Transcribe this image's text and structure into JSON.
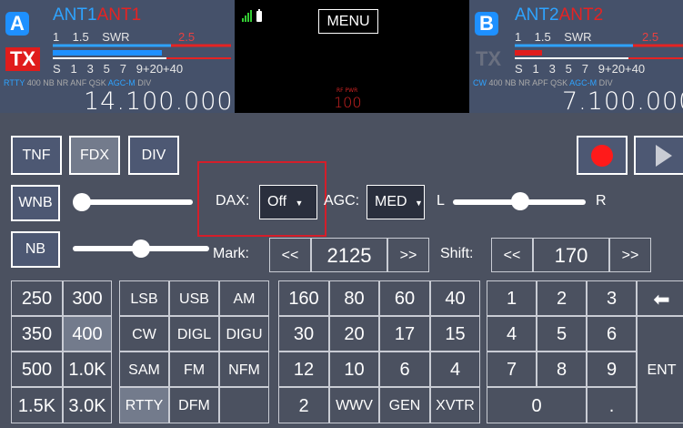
{
  "slice_a": {
    "letter": "A",
    "ant_rx": "ANT1",
    "ant_tx": "ANT1",
    "tx_badge": "TX",
    "meter_scale_top": "1    1.5    SWR",
    "meter_scale_top_red": "2.5",
    "meter_scale_top_red2": "",
    "meter_scale_bottom": "S   1   3   5   7   9+20+40",
    "mode": "RTTY",
    "filter": "400",
    "flags": "NB NR ANF QSK",
    "agc": "AGC-M",
    "div": "DIV",
    "frequency": "14.100.000"
  },
  "center": {
    "menu_label": "MENU",
    "rfpwr_label": "RF PWR",
    "rfpwr_value": "100"
  },
  "slice_b": {
    "letter": "B",
    "ant_rx": "ANT2",
    "ant_tx": "ANT2",
    "tx_badge": "TX",
    "meter_scale_top": "1    1.5    SWR",
    "meter_scale_top_red": "2.5",
    "meter_scale_bottom": "S   1   3   5   7   9+20+40",
    "mode": "CW",
    "filter": "400",
    "flags": "NB NR APF QSK",
    "agc": "AGC-M",
    "div": "DIV",
    "frequency": "7.100.000"
  },
  "toolbar": {
    "tnf": "TNF",
    "fdx": "FDX",
    "div": "DIV"
  },
  "controls": {
    "wnb": "WNB",
    "nb": "NB",
    "dax_label": "DAX:",
    "dax_value": "Off",
    "agc_label": "AGC:",
    "agc_value": "MED",
    "pan_left": "L",
    "pan_right": "R",
    "mark_label": "Mark:",
    "mark_down": "<<",
    "mark_value": "2125",
    "mark_up": ">>",
    "shift_label": "Shift:",
    "shift_down": "<<",
    "shift_value": "170",
    "shift_up": ">>"
  },
  "filters": [
    "250",
    "300",
    "350",
    "400",
    "500",
    "1.0K",
    "1.5K",
    "3.0K"
  ],
  "modes": [
    "LSB",
    "USB",
    "AM",
    "CW",
    "DIGL",
    "DIGU",
    "SAM",
    "FM",
    "NFM",
    "RTTY",
    "DFM",
    ""
  ],
  "bands": [
    "160",
    "80",
    "60",
    "40",
    "30",
    "20",
    "17",
    "15",
    "12",
    "10",
    "6",
    "4",
    "2",
    "WWV",
    "GEN",
    "XVTR"
  ],
  "keypad": [
    "1",
    "2",
    "3",
    "4",
    "5",
    "6",
    "7",
    "8",
    "9",
    "0",
    "."
  ],
  "keypad_back": "⬅",
  "keypad_ent": "ENT",
  "colors": {
    "accent": "#1e90ff",
    "tx_red": "#e01c1c",
    "record": "#ff1a1a",
    "highlight_box": "#d41e2a"
  }
}
